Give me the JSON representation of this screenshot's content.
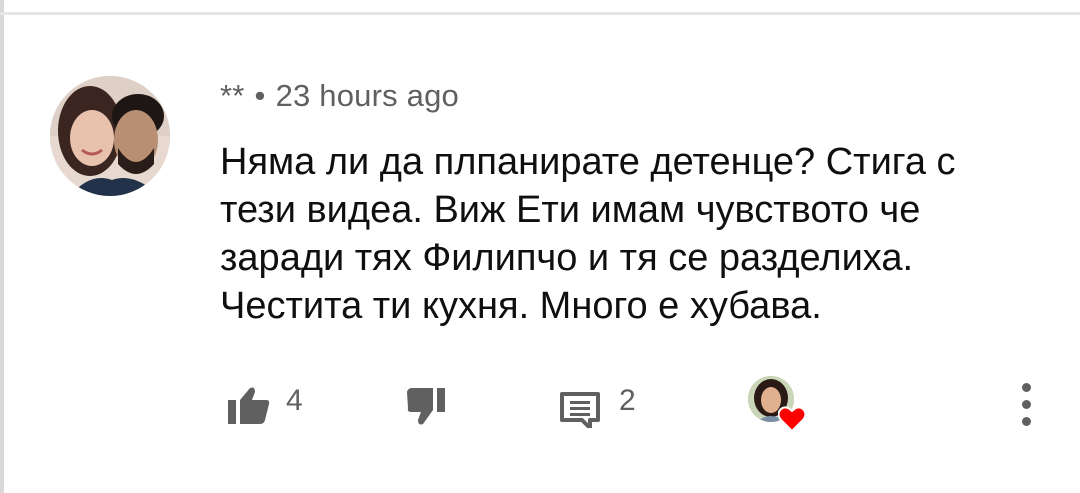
{
  "comment": {
    "author": "**",
    "separator": "•",
    "timestamp": "23 hours ago",
    "text_lines": [
      "Няма ли да плпанирате детенце? Стига с",
      "тези видеа. Виж Ети имам чувството че",
      "заради тях Филипчо и тя се разделиха.",
      "Честита ти кухня. Много е хубава."
    ]
  },
  "actions": {
    "like_count": "4",
    "reply_count": "2"
  },
  "icons": {
    "like": "thumbs-up-icon",
    "dislike": "thumbs-down-icon",
    "reply": "reply-comment-icon",
    "heart": "creator-heart-icon",
    "more": "more-vertical-icon"
  },
  "colors": {
    "text_primary": "#0f0f0f",
    "text_secondary": "#606060",
    "heart_red": "#ff0000",
    "background": "#ffffff"
  }
}
